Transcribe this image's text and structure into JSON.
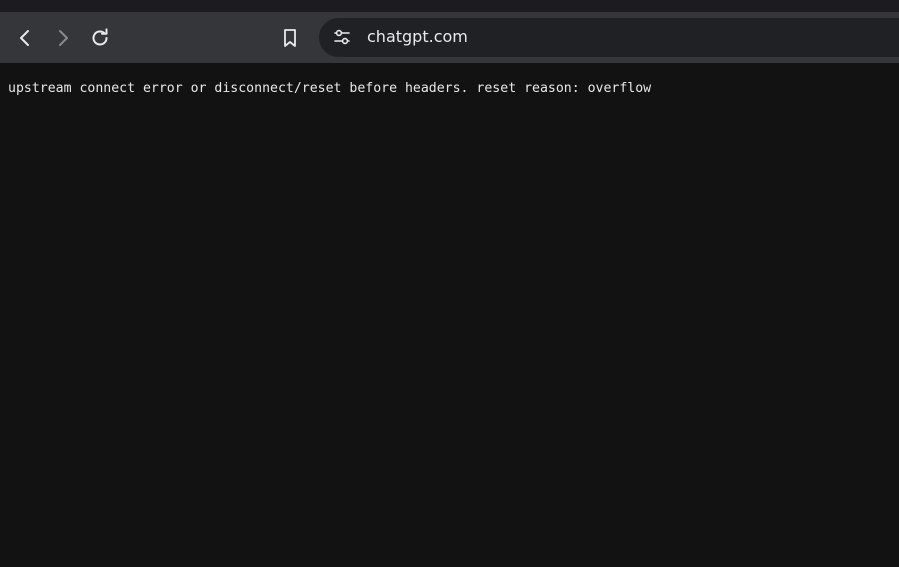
{
  "browser": {
    "url": "chatgpt.com",
    "icons": {
      "back": "chevron-left-icon",
      "forward": "chevron-right-icon",
      "reload": "reload-icon",
      "bookmark": "bookmark-icon",
      "site_info": "tune-icon"
    },
    "colors": {
      "toolbar": "#35363a",
      "omnibox": "#202124",
      "page_background": "#121212",
      "text": "#e8e8e8"
    }
  },
  "page": {
    "error_message": "upstream connect error or disconnect/reset before headers. reset reason: overflow"
  }
}
